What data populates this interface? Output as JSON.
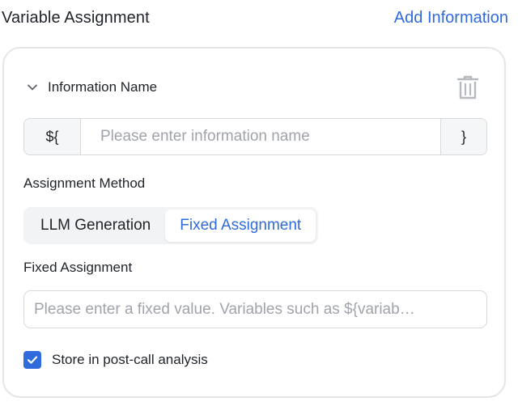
{
  "header": {
    "title": "Variable Assignment",
    "add_link": "Add Information"
  },
  "info": {
    "title": "Information Name",
    "chevron_icon": "chevron-down-icon",
    "delete_icon": "trash-icon",
    "name_prefix": "${",
    "name_suffix": "}",
    "name_placeholder": "Please enter information name",
    "name_value": ""
  },
  "assignment": {
    "label": "Assignment Method",
    "options": [
      "LLM Generation",
      "Fixed Assignment"
    ],
    "selected": "Fixed Assignment"
  },
  "fixed": {
    "label": "Fixed Assignment",
    "placeholder": "Please enter a fixed value. Variables such as ${variab…",
    "value": ""
  },
  "store": {
    "label": "Store in post-call analysis",
    "checked": true
  },
  "colors": {
    "accent": "#2f6bdb",
    "border": "#d6d9dd",
    "muted_text": "#a0a4aa"
  }
}
